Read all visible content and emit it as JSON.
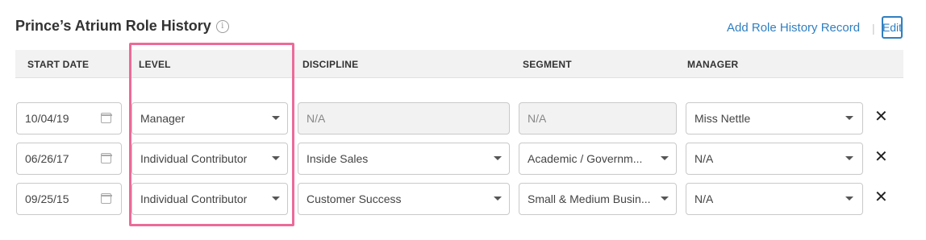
{
  "section": {
    "title": "Prince’s Atrium Role History",
    "info_icon": "i",
    "add_label": "Add Role History Record",
    "separator": "|",
    "edit_label": "Edit"
  },
  "columns": {
    "start_date": "START DATE",
    "level": "LEVEL",
    "discipline": "DISCIPLINE",
    "segment": "SEGMENT",
    "manager": "MANAGER"
  },
  "rows": [
    {
      "start_date": "10/04/19",
      "level": "Manager",
      "discipline": "N/A",
      "segment": "N/A",
      "manager": "Miss Nettle"
    },
    {
      "start_date": "06/26/17",
      "level": "Individual Contributor",
      "discipline": "Inside Sales",
      "segment": "Academic / Governm...",
      "manager": "N/A"
    },
    {
      "start_date": "09/25/15",
      "level": "Individual Contributor",
      "discipline": "Customer Success",
      "segment": "Small & Medium Busin...",
      "manager": "N/A"
    }
  ],
  "colors": {
    "link": "#2f7fc1",
    "highlight": "#ec6a98",
    "header_bg": "#f2f2f2"
  }
}
